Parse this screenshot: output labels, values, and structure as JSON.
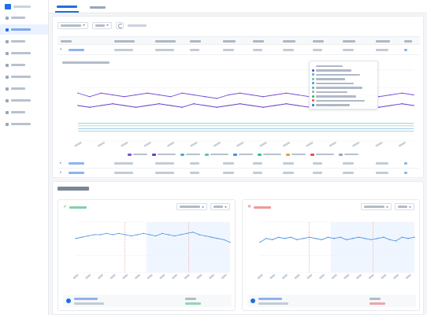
{
  "app": {
    "title": ""
  },
  "sidebar": {
    "items": [
      {
        "label": ""
      },
      {
        "label": ""
      },
      {
        "label": ""
      },
      {
        "label": ""
      },
      {
        "label": ""
      },
      {
        "label": ""
      },
      {
        "label": ""
      },
      {
        "label": ""
      },
      {
        "label": ""
      },
      {
        "label": ""
      }
    ]
  },
  "tabs": [
    {
      "label": ""
    },
    {
      "label": ""
    }
  ],
  "toolbar": {
    "metric_select": "",
    "range_select": "",
    "hint": ""
  },
  "table": {
    "headers": [
      "",
      "",
      "",
      "",
      "",
      "",
      "",
      "",
      "",
      "",
      ""
    ],
    "rows": [
      [],
      [],
      [],
      []
    ]
  },
  "chart_data": [
    {
      "type": "line",
      "title": "",
      "y_ticks": [
        "",
        "",
        "",
        "",
        ""
      ],
      "series": [
        {
          "color": "#7b4fd6",
          "values": [
            27,
            25,
            27,
            26,
            25,
            26,
            27,
            26,
            25,
            27,
            26,
            25,
            24,
            26,
            27,
            26,
            25,
            26,
            27,
            26,
            25,
            26,
            27,
            26,
            27,
            26,
            25,
            26,
            27,
            26
          ]
        },
        {
          "color": "#6a3fc8",
          "values": [
            20,
            19,
            20,
            21,
            20,
            19,
            20,
            21,
            20,
            19,
            21,
            20,
            19,
            20,
            21,
            20,
            19,
            20,
            21,
            20,
            19,
            20,
            19,
            20,
            21,
            20,
            19,
            20,
            21,
            20
          ]
        },
        {
          "color": "#3fb6c9",
          "values": [
            10,
            10,
            10,
            10,
            10,
            10,
            10,
            10,
            10,
            10,
            10,
            10,
            10,
            10,
            10,
            10,
            10,
            10,
            10,
            10,
            10,
            10,
            10,
            10,
            10,
            10,
            10,
            10,
            10,
            10
          ]
        },
        {
          "color": "#5ac8a8",
          "values": [
            8.5,
            8.5,
            8.5,
            8.5,
            8.5,
            8.5,
            8.5,
            8.5,
            8.5,
            8.5,
            8.5,
            8.5,
            8.5,
            8.5,
            8.5,
            8.5,
            8.5,
            8.5,
            8.5,
            8.5,
            8.5,
            8.5,
            8.5,
            8.5,
            8.5,
            8.5,
            8.5,
            8.5,
            8.5,
            8.5
          ]
        },
        {
          "color": "#4a90e2",
          "values": [
            7,
            7,
            7,
            7,
            7,
            7,
            7,
            7,
            7,
            7,
            7,
            7,
            7,
            7,
            7,
            7,
            7,
            7,
            7,
            7,
            7,
            7,
            7,
            7,
            7,
            7,
            7,
            7,
            7,
            7
          ]
        },
        {
          "color": "#2fc4a0",
          "values": [
            5.5,
            5.5,
            5.5,
            5.5,
            5.5,
            5.5,
            5.5,
            5.5,
            5.5,
            5.5,
            5.5,
            5.5,
            5.5,
            5.5,
            5.5,
            5.5,
            5.5,
            5.5,
            5.5,
            5.5,
            5.5,
            5.5,
            5.5,
            5.5,
            5.5,
            5.5,
            5.5,
            5.5,
            5.5,
            5.5
          ]
        }
      ],
      "ylim": [
        0,
        40
      ]
    },
    {
      "type": "line",
      "y_ticks": [
        "",
        "",
        "",
        ""
      ],
      "series": [
        {
          "color": "#4a90e2",
          "values": [
            27,
            28,
            29,
            30,
            30,
            31,
            30,
            31,
            30,
            29,
            30,
            31,
            30,
            29,
            31,
            30,
            29,
            30,
            31,
            32,
            30,
            29,
            28,
            27,
            26,
            24
          ]
        }
      ],
      "ylim": [
        0,
        40
      ]
    },
    {
      "type": "line",
      "y_ticks": [
        "",
        "",
        "",
        ""
      ],
      "series": [
        {
          "color": "#4a90e2",
          "values": [
            24,
            27,
            26,
            28,
            27,
            28,
            26,
            27,
            28,
            27,
            26,
            28,
            27,
            28,
            26,
            27,
            28,
            27,
            26,
            27,
            28,
            26,
            25,
            28,
            27,
            28
          ]
        }
      ],
      "ylim": [
        0,
        40
      ]
    }
  ],
  "section2": {
    "title": ""
  },
  "cards": [
    {
      "status": "",
      "label": "",
      "status_color": "#2fb36b",
      "foot_name": "",
      "foot_sub": "",
      "foot_value": "",
      "foot_delta": ""
    },
    {
      "status": "",
      "label": "",
      "status_color": "#e2554f",
      "foot_name": "",
      "foot_sub": "",
      "foot_value": "",
      "foot_delta": ""
    }
  ]
}
